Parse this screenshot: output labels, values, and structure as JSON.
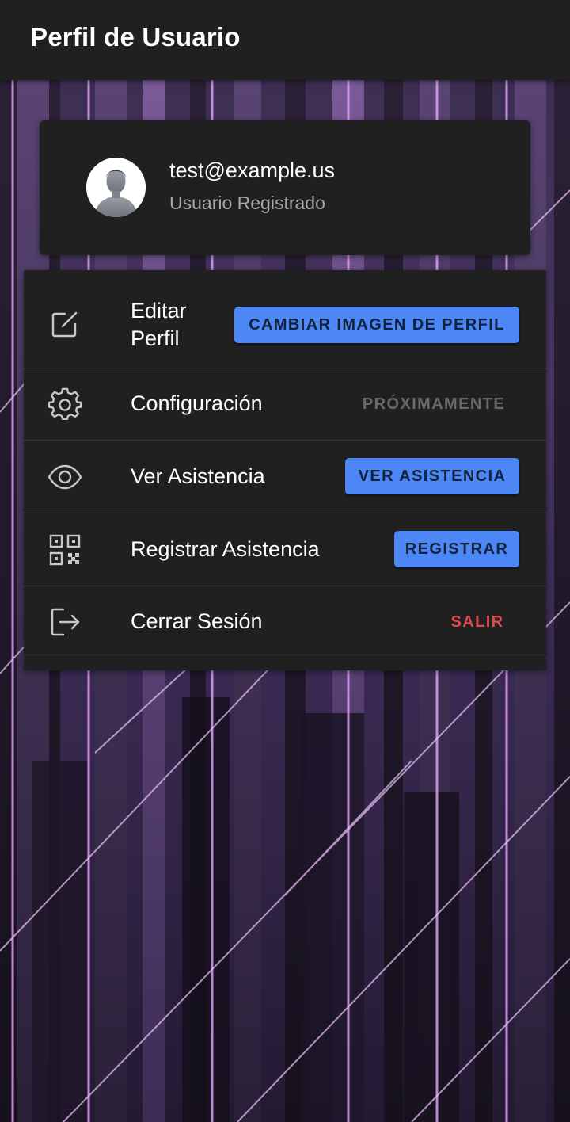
{
  "app_bar": {
    "title": "Perfil de Usuario"
  },
  "profile": {
    "email": "test@example.us",
    "role": "Usuario Registrado",
    "avatar_icon": "default-user-avatar-icon"
  },
  "menu": {
    "items": [
      {
        "label_line1": "Editar",
        "label_line2": "Perfil",
        "icon": "edit-square-icon",
        "action_label": "CAMBIAR IMAGEN DE PERFIL",
        "action_style": "primary"
      },
      {
        "label": "Configuración",
        "icon": "gear-icon",
        "action_label": "PRÓXIMAMENTE",
        "action_style": "disabled"
      },
      {
        "label": "Ver Asistencia",
        "icon": "eye-icon",
        "action_label": "VER ASISTENCIA",
        "action_style": "primary"
      },
      {
        "label": "Registrar Asistencia",
        "icon": "qr-code-icon",
        "action_label": "REGISTRAR",
        "action_style": "primary"
      },
      {
        "label": "Cerrar Sesión",
        "icon": "logout-icon",
        "action_label": "SALIR",
        "action_style": "danger"
      }
    ]
  },
  "colors": {
    "app_bar": "#202020",
    "card": "#202020",
    "primary_button": "#4d86f5",
    "danger_text": "#e0484a",
    "disabled_text": "#6a6a6a",
    "secondary_text": "#a7a7a7"
  }
}
